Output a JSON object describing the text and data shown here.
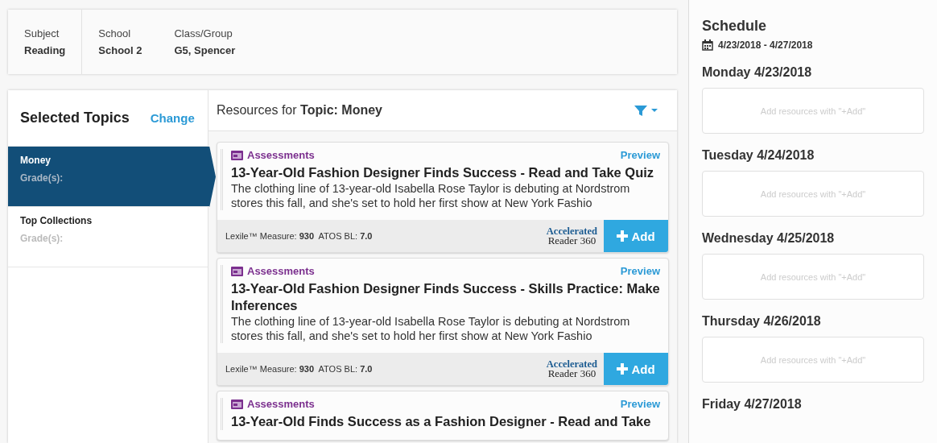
{
  "info_bar": [
    {
      "label": "Subject",
      "value": "Reading"
    },
    {
      "label": "School",
      "value": "School 2"
    },
    {
      "label": "Class/Group",
      "value": "G5, Spencer"
    }
  ],
  "topics": {
    "title": "Selected Topics",
    "change_link": "Change",
    "items": [
      {
        "name": "Money",
        "grades_label": "Grade(s):",
        "selected": true
      },
      {
        "name": "Top Collections",
        "grades_label": "Grade(s):",
        "selected": false
      }
    ]
  },
  "resources": {
    "heading_prefix": "Resources for",
    "heading_topic": "Topic: Money",
    "cards": [
      {
        "category": "Assessments",
        "preview": "Preview",
        "title": "13-Year-Old Fashion Designer Finds Success - Read and Take Quiz",
        "description": "The clothing line of 13-year-old Isabella Rose Taylor is debuting at Nordstrom stores this fall, and she's set to hold her first show at New York Fashio",
        "measures": "Lexile™ Measure: **930**  ATOS BL: **7.0**",
        "logo_top": "Accelerated",
        "logo_bottom": "Reader 360",
        "add_label": "Add"
      },
      {
        "category": "Assessments",
        "preview": "Preview",
        "title": "13-Year-Old Fashion Designer Finds Success - Skills Practice: Make Inferences",
        "description": "The clothing line of 13-year-old Isabella Rose Taylor is debuting at Nordstrom stores this fall, and she's set to hold her first show at New York Fashio",
        "measures": "Lexile™ Measure: **930**  ATOS BL: **7.0**",
        "logo_top": "Accelerated",
        "logo_bottom": "Reader 360",
        "add_label": "Add"
      },
      {
        "category": "Assessments",
        "preview": "Preview",
        "title": "13-Year-Old Finds Success as a Fashion Designer - Read and Take"
      }
    ]
  },
  "schedule": {
    "title": "Schedule",
    "date_range": "4/23/2018 - 4/27/2018",
    "days": [
      {
        "heading": "Monday 4/23/2018",
        "placeholder": "Add resources with \"+Add\""
      },
      {
        "heading": "Tuesday 4/24/2018",
        "placeholder": "Add resources with \"+Add\""
      },
      {
        "heading": "Wednesday 4/25/2018",
        "placeholder": "Add resources with \"+Add\""
      },
      {
        "heading": "Thursday 4/26/2018",
        "placeholder": "Add resources with \"+Add\""
      },
      {
        "heading": "Friday 4/27/2018"
      }
    ]
  }
}
